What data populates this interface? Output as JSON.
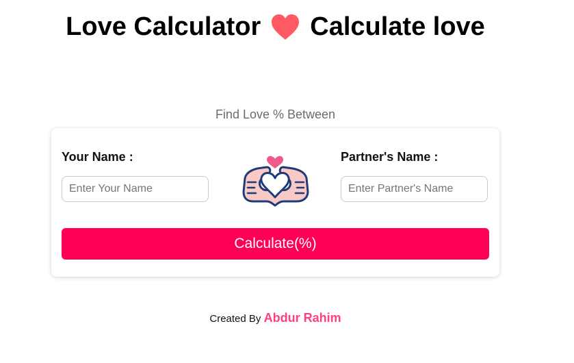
{
  "header": {
    "title_left": "Love Calculator",
    "title_right": "Calculate love"
  },
  "subtitle": "Find Love % Between",
  "form": {
    "your_name_label": "Your Name :",
    "your_name_placeholder": "Enter Your Name",
    "your_name_value": "",
    "partner_name_label": "Partner's Name :",
    "partner_name_placeholder": "Enter Partner's Name",
    "partner_name_value": "",
    "calculate_label": "Calculate(%)"
  },
  "footer": {
    "created_by": "Created By",
    "author": "Abdur Rahim"
  },
  "icons": {
    "title_heart": "heart-icon",
    "hands": "heart-hands-icon"
  },
  "colors": {
    "accent": "#ff0055",
    "heart": "#ff5a64",
    "author": "#ff3e86",
    "hands_outline": "#1f3a78",
    "hands_fill": "#f9c9c5",
    "small_heart": "#ee5a8a"
  }
}
